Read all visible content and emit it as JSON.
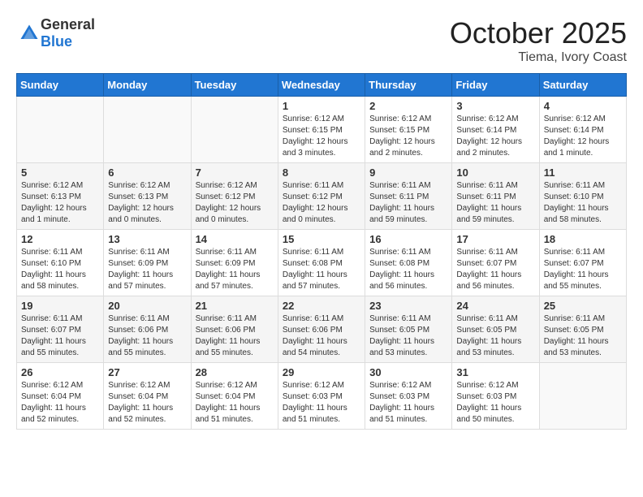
{
  "header": {
    "logo_general": "General",
    "logo_blue": "Blue",
    "month": "October 2025",
    "location": "Tiema, Ivory Coast"
  },
  "weekdays": [
    "Sunday",
    "Monday",
    "Tuesday",
    "Wednesday",
    "Thursday",
    "Friday",
    "Saturday"
  ],
  "weeks": [
    [
      {
        "day": "",
        "info": ""
      },
      {
        "day": "",
        "info": ""
      },
      {
        "day": "",
        "info": ""
      },
      {
        "day": "1",
        "info": "Sunrise: 6:12 AM\nSunset: 6:15 PM\nDaylight: 12 hours and 3 minutes."
      },
      {
        "day": "2",
        "info": "Sunrise: 6:12 AM\nSunset: 6:15 PM\nDaylight: 12 hours and 2 minutes."
      },
      {
        "day": "3",
        "info": "Sunrise: 6:12 AM\nSunset: 6:14 PM\nDaylight: 12 hours and 2 minutes."
      },
      {
        "day": "4",
        "info": "Sunrise: 6:12 AM\nSunset: 6:14 PM\nDaylight: 12 hours and 1 minute."
      }
    ],
    [
      {
        "day": "5",
        "info": "Sunrise: 6:12 AM\nSunset: 6:13 PM\nDaylight: 12 hours and 1 minute."
      },
      {
        "day": "6",
        "info": "Sunrise: 6:12 AM\nSunset: 6:13 PM\nDaylight: 12 hours and 0 minutes."
      },
      {
        "day": "7",
        "info": "Sunrise: 6:12 AM\nSunset: 6:12 PM\nDaylight: 12 hours and 0 minutes."
      },
      {
        "day": "8",
        "info": "Sunrise: 6:11 AM\nSunset: 6:12 PM\nDaylight: 12 hours and 0 minutes."
      },
      {
        "day": "9",
        "info": "Sunrise: 6:11 AM\nSunset: 6:11 PM\nDaylight: 11 hours and 59 minutes."
      },
      {
        "day": "10",
        "info": "Sunrise: 6:11 AM\nSunset: 6:11 PM\nDaylight: 11 hours and 59 minutes."
      },
      {
        "day": "11",
        "info": "Sunrise: 6:11 AM\nSunset: 6:10 PM\nDaylight: 11 hours and 58 minutes."
      }
    ],
    [
      {
        "day": "12",
        "info": "Sunrise: 6:11 AM\nSunset: 6:10 PM\nDaylight: 11 hours and 58 minutes."
      },
      {
        "day": "13",
        "info": "Sunrise: 6:11 AM\nSunset: 6:09 PM\nDaylight: 11 hours and 57 minutes."
      },
      {
        "day": "14",
        "info": "Sunrise: 6:11 AM\nSunset: 6:09 PM\nDaylight: 11 hours and 57 minutes."
      },
      {
        "day": "15",
        "info": "Sunrise: 6:11 AM\nSunset: 6:08 PM\nDaylight: 11 hours and 57 minutes."
      },
      {
        "day": "16",
        "info": "Sunrise: 6:11 AM\nSunset: 6:08 PM\nDaylight: 11 hours and 56 minutes."
      },
      {
        "day": "17",
        "info": "Sunrise: 6:11 AM\nSunset: 6:07 PM\nDaylight: 11 hours and 56 minutes."
      },
      {
        "day": "18",
        "info": "Sunrise: 6:11 AM\nSunset: 6:07 PM\nDaylight: 11 hours and 55 minutes."
      }
    ],
    [
      {
        "day": "19",
        "info": "Sunrise: 6:11 AM\nSunset: 6:07 PM\nDaylight: 11 hours and 55 minutes."
      },
      {
        "day": "20",
        "info": "Sunrise: 6:11 AM\nSunset: 6:06 PM\nDaylight: 11 hours and 55 minutes."
      },
      {
        "day": "21",
        "info": "Sunrise: 6:11 AM\nSunset: 6:06 PM\nDaylight: 11 hours and 55 minutes."
      },
      {
        "day": "22",
        "info": "Sunrise: 6:11 AM\nSunset: 6:06 PM\nDaylight: 11 hours and 54 minutes."
      },
      {
        "day": "23",
        "info": "Sunrise: 6:11 AM\nSunset: 6:05 PM\nDaylight: 11 hours and 53 minutes."
      },
      {
        "day": "24",
        "info": "Sunrise: 6:11 AM\nSunset: 6:05 PM\nDaylight: 11 hours and 53 minutes."
      },
      {
        "day": "25",
        "info": "Sunrise: 6:11 AM\nSunset: 6:05 PM\nDaylight: 11 hours and 53 minutes."
      }
    ],
    [
      {
        "day": "26",
        "info": "Sunrise: 6:12 AM\nSunset: 6:04 PM\nDaylight: 11 hours and 52 minutes."
      },
      {
        "day": "27",
        "info": "Sunrise: 6:12 AM\nSunset: 6:04 PM\nDaylight: 11 hours and 52 minutes."
      },
      {
        "day": "28",
        "info": "Sunrise: 6:12 AM\nSunset: 6:04 PM\nDaylight: 11 hours and 51 minutes."
      },
      {
        "day": "29",
        "info": "Sunrise: 6:12 AM\nSunset: 6:03 PM\nDaylight: 11 hours and 51 minutes."
      },
      {
        "day": "30",
        "info": "Sunrise: 6:12 AM\nSunset: 6:03 PM\nDaylight: 11 hours and 51 minutes."
      },
      {
        "day": "31",
        "info": "Sunrise: 6:12 AM\nSunset: 6:03 PM\nDaylight: 11 hours and 50 minutes."
      },
      {
        "day": "",
        "info": ""
      }
    ]
  ]
}
